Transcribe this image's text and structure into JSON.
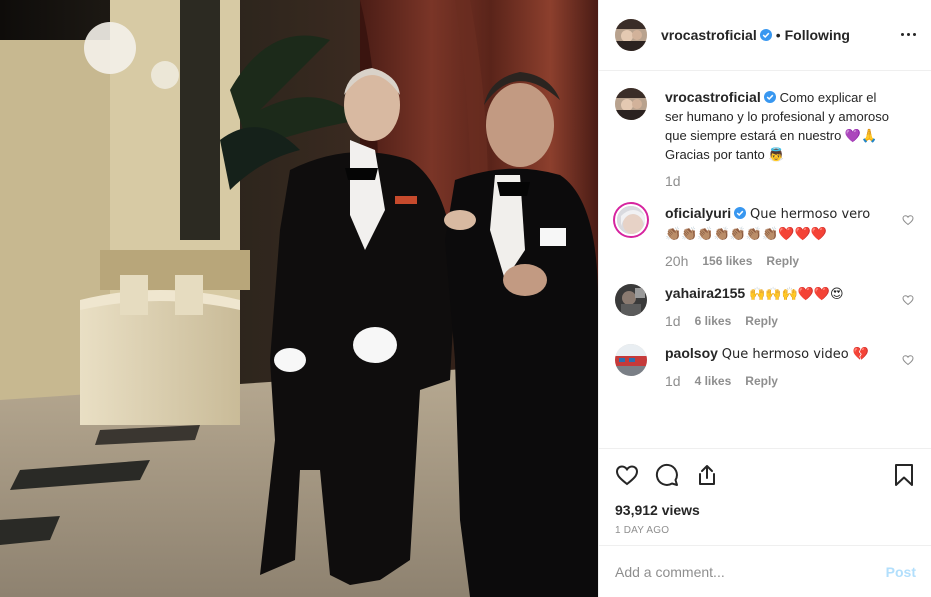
{
  "post": {
    "username": "vrocastroficial",
    "follow_status": "Following",
    "separator": "•",
    "caption": "Como explicar el ser humano y lo profesional y amoroso que siempre estará en nuestro 💜🙏 Gracias por tanto 👼",
    "caption_time": "1d",
    "views": "93,912 views",
    "posted_ago": "1 DAY AGO"
  },
  "comments": [
    {
      "username": "oficialyuri",
      "verified": true,
      "text": "Que hermoso vero 👏🏽👏🏽👏🏽👏🏽👏🏽👏🏽👏🏽❤️❤️❤️",
      "time": "20h",
      "likes": "156 likes",
      "reply": "Reply"
    },
    {
      "username": "yahaira2155",
      "verified": false,
      "text": "🙌🙌🙌❤️❤️😍",
      "time": "1d",
      "likes": "6 likes",
      "reply": "Reply"
    },
    {
      "username": "paolsoy",
      "verified": false,
      "text": "Que hermoso video 💔",
      "time": "1d",
      "likes": "4 likes",
      "reply": "Reply"
    }
  ],
  "add_comment": {
    "placeholder": "Add a comment...",
    "post_label": "Post"
  },
  "icons": {
    "verified": "verified-badge-icon",
    "more": "more-options-icon",
    "like": "heart-icon",
    "comment": "comment-icon",
    "share": "share-icon",
    "save": "bookmark-icon"
  },
  "colors": {
    "verified_blue": "#3897f0",
    "muted": "#8e8e8e",
    "text": "#262626",
    "post_disabled": "#b2dffc",
    "border": "#efefef"
  }
}
